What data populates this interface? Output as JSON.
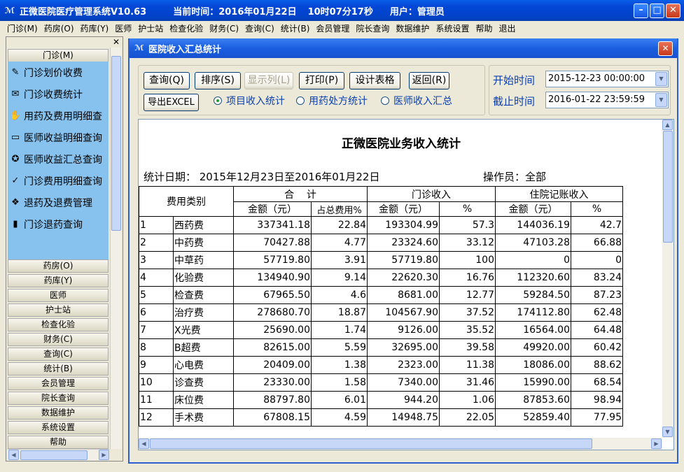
{
  "window": {
    "title": "正微医院医疗管理系统V10.63",
    "time_label": "当前时间：",
    "date": "2016年01月22日",
    "time": "10时07分17秒",
    "user_label": "用户：",
    "user": "管理员"
  },
  "menu": [
    "门诊(M)",
    "药房(O)",
    "药库(Y)",
    "医师",
    "护士站",
    "检查化验",
    "财务(C)",
    "查询(C)",
    "统计(B)",
    "会员管理",
    "院长查询",
    "数据维护",
    "系统设置",
    "帮助",
    "退出"
  ],
  "sidebar": {
    "close": "✕",
    "top_group": "门诊(M)",
    "items": [
      {
        "label": "门诊划价收费",
        "icon": "✎"
      },
      {
        "label": "门诊收费统计",
        "icon": "✉"
      },
      {
        "label": "用药及费用明细查",
        "icon": "✋"
      },
      {
        "label": "医师收益明细查询",
        "icon": "▭"
      },
      {
        "label": "医师收益汇总查询",
        "icon": "✪"
      },
      {
        "label": "门诊费用明细查询",
        "icon": "✓"
      },
      {
        "label": "退药及退费管理",
        "icon": "❖"
      },
      {
        "label": "门诊退药查询",
        "icon": "▮"
      }
    ],
    "groups": [
      "药房(O)",
      "药库(Y)",
      "医师",
      "护士站",
      "检查化验",
      "财务(C)",
      "查询(C)",
      "统计(B)",
      "会员管理",
      "院长查询",
      "数据维护",
      "系统设置",
      "帮助"
    ]
  },
  "child": {
    "title": "医院收入汇总统计",
    "close": "✕"
  },
  "toolbar": {
    "buttons": [
      {
        "label": "查询(Q)",
        "enabled": true
      },
      {
        "label": "排序(S)",
        "enabled": true
      },
      {
        "label": "显示列(L)",
        "enabled": false
      },
      {
        "label": "打印(P)",
        "enabled": true
      },
      {
        "label": "设计表格",
        "enabled": true
      },
      {
        "label": "返回(R)",
        "enabled": true
      },
      {
        "label": "导出EXCEL",
        "enabled": true
      }
    ],
    "radios": [
      {
        "label": "项目收入统计",
        "selected": true
      },
      {
        "label": "用药处方统计",
        "selected": false
      },
      {
        "label": "医师收入汇总",
        "selected": false
      }
    ]
  },
  "dates": {
    "start_label": "开始时间",
    "start": "2015-12-23 00:00:00",
    "end_label": "截止时间",
    "end": "2016-01-22 23:59:59"
  },
  "report": {
    "title": "正微医院业务收入统计",
    "date_range": "统计日期：  2015年12月23日至2016年01月22日",
    "operator": "操作员：全部",
    "headers": {
      "category": "费用类别",
      "total": "合    计",
      "outpatient": "门诊收入",
      "inpatient": "住院记账收入",
      "amount": "金额（元）",
      "share": "占总费用%",
      "pct": "%"
    },
    "rows": [
      {
        "no": "1",
        "name": "西药费",
        "total": "337341.18",
        "share": "22.84",
        "op_amt": "193304.99",
        "op_pct": "57.3",
        "ip_amt": "144036.19",
        "ip_pct": "42.7"
      },
      {
        "no": "2",
        "name": "中药费",
        "total": "70427.88",
        "share": "4.77",
        "op_amt": "23324.60",
        "op_pct": "33.12",
        "ip_amt": "47103.28",
        "ip_pct": "66.88"
      },
      {
        "no": "3",
        "name": "中草药",
        "total": "57719.80",
        "share": "3.91",
        "op_amt": "57719.80",
        "op_pct": "100",
        "ip_amt": "0",
        "ip_pct": "0"
      },
      {
        "no": "4",
        "name": "化验费",
        "total": "134940.90",
        "share": "9.14",
        "op_amt": "22620.30",
        "op_pct": "16.76",
        "ip_amt": "112320.60",
        "ip_pct": "83.24"
      },
      {
        "no": "5",
        "name": "检查费",
        "total": "67965.50",
        "share": "4.6",
        "op_amt": "8681.00",
        "op_pct": "12.77",
        "ip_amt": "59284.50",
        "ip_pct": "87.23"
      },
      {
        "no": "6",
        "name": "治疗费",
        "total": "278680.70",
        "share": "18.87",
        "op_amt": "104567.90",
        "op_pct": "37.52",
        "ip_amt": "174112.80",
        "ip_pct": "62.48"
      },
      {
        "no": "7",
        "name": "X光费",
        "total": "25690.00",
        "share": "1.74",
        "op_amt": "9126.00",
        "op_pct": "35.52",
        "ip_amt": "16564.00",
        "ip_pct": "64.48"
      },
      {
        "no": "8",
        "name": "B超费",
        "total": "82615.00",
        "share": "5.59",
        "op_amt": "32695.00",
        "op_pct": "39.58",
        "ip_amt": "49920.00",
        "ip_pct": "60.42"
      },
      {
        "no": "9",
        "name": "心电费",
        "total": "20409.00",
        "share": "1.38",
        "op_amt": "2323.00",
        "op_pct": "11.38",
        "ip_amt": "18086.00",
        "ip_pct": "88.62"
      },
      {
        "no": "10",
        "name": "诊查费",
        "total": "23330.00",
        "share": "1.58",
        "op_amt": "7340.00",
        "op_pct": "31.46",
        "ip_amt": "15990.00",
        "ip_pct": "68.54"
      },
      {
        "no": "11",
        "name": "床位费",
        "total": "88797.80",
        "share": "6.01",
        "op_amt": "944.20",
        "op_pct": "1.06",
        "ip_amt": "87853.60",
        "ip_pct": "98.94"
      },
      {
        "no": "12",
        "name": "手术费",
        "total": "67808.15",
        "share": "4.59",
        "op_amt": "14948.75",
        "op_pct": "22.05",
        "ip_amt": "52859.40",
        "ip_pct": "77.95"
      }
    ]
  }
}
